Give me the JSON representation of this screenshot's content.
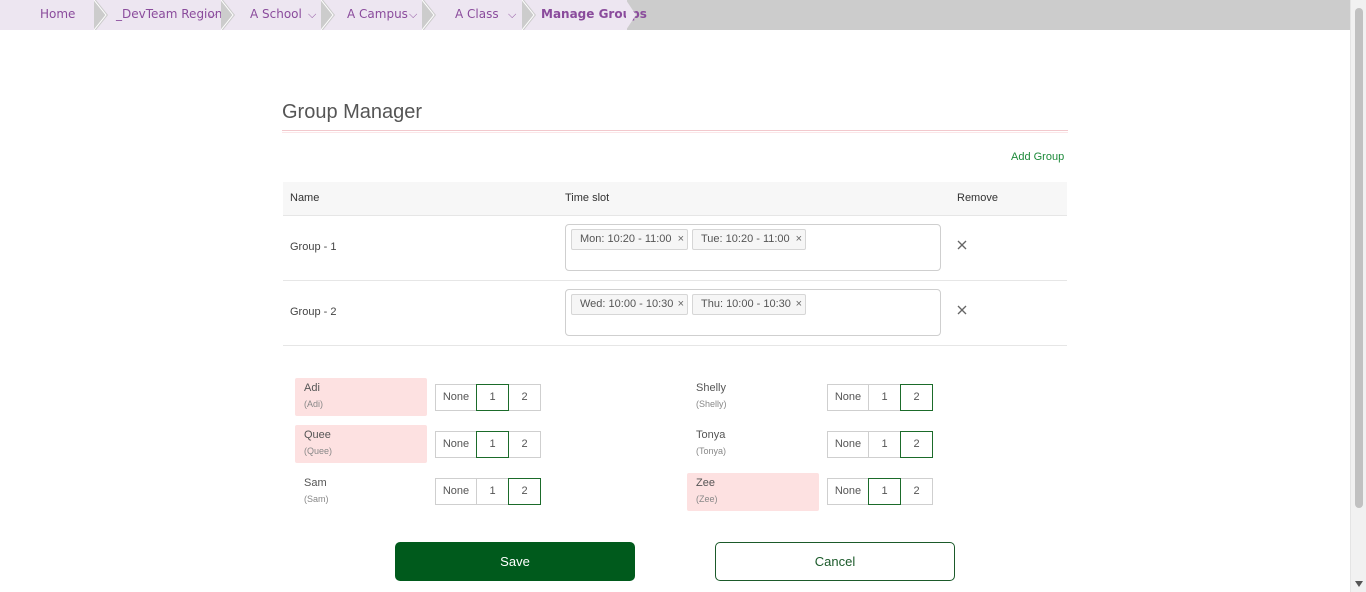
{
  "breadcrumb": {
    "items": [
      {
        "label": "Home",
        "dropdown": false
      },
      {
        "label": "_DevTeam Region",
        "dropdown": true
      },
      {
        "label": "A School",
        "dropdown": true
      },
      {
        "label": "A Campus",
        "dropdown": true
      },
      {
        "label": "A Class",
        "dropdown": true
      },
      {
        "label": "Manage Groups",
        "dropdown": false,
        "active": true
      }
    ]
  },
  "page": {
    "title": "Group Manager",
    "add_group_label": "Add Group"
  },
  "table": {
    "headers": {
      "name": "Name",
      "time_slot": "Time slot",
      "remove": "Remove"
    },
    "rows": [
      {
        "name": "Group - 1",
        "slots": [
          "Mon: 10:20 - 11:00",
          "Tue: 10:20 - 11:00"
        ]
      },
      {
        "name": "Group - 2",
        "slots": [
          "Wed: 10:00 - 10:30",
          "Thu: 10:00 - 10:30"
        ]
      }
    ],
    "remove_icon": "close-icon",
    "tag_remove_glyph": "×"
  },
  "students": [
    {
      "name": "Adi",
      "alias": "(Adi)",
      "highlighted": true,
      "selected": "1"
    },
    {
      "name": "Shelly",
      "alias": "(Shelly)",
      "highlighted": false,
      "selected": "2"
    },
    {
      "name": "Quee",
      "alias": "(Quee)",
      "highlighted": true,
      "selected": "1"
    },
    {
      "name": "Tonya",
      "alias": "(Tonya)",
      "highlighted": false,
      "selected": "2"
    },
    {
      "name": "Sam",
      "alias": "(Sam)",
      "highlighted": false,
      "selected": "2"
    },
    {
      "name": "Zee",
      "alias": "(Zee)",
      "highlighted": true,
      "selected": "1"
    }
  ],
  "group_options": [
    "None",
    "1",
    "2"
  ],
  "actions": {
    "save_label": "Save",
    "cancel_label": "Cancel"
  },
  "colors": {
    "accent_purple": "#8a4b9c",
    "breadcrumb_bg": "#ede6f1",
    "primary_green": "#005a1c",
    "highlight_pink": "#fde1e1",
    "link_green": "#1d8a3a"
  }
}
